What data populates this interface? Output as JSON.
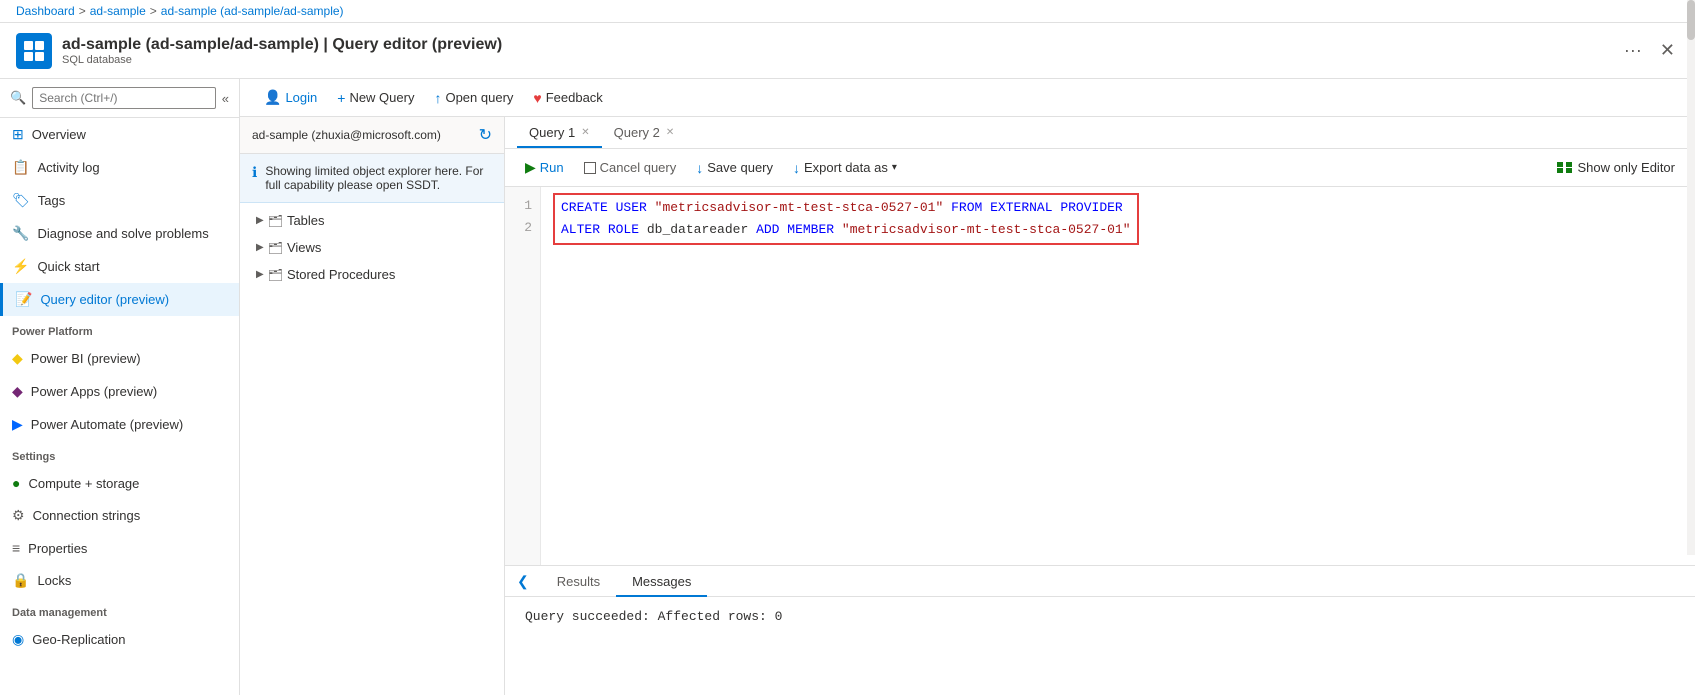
{
  "breadcrumb": {
    "items": [
      "Dashboard",
      "ad-sample",
      "ad-sample (ad-sample/ad-sample)"
    ]
  },
  "header": {
    "title": "ad-sample (ad-sample/ad-sample) | Query editor (preview)",
    "subtitle": "SQL database",
    "dots_label": "···",
    "close_label": "✕"
  },
  "sidebar": {
    "search_placeholder": "Search (Ctrl+/)",
    "collapse_icon": "«",
    "nav_items": [
      {
        "id": "overview",
        "label": "Overview",
        "icon": "overview"
      },
      {
        "id": "activity-log",
        "label": "Activity log",
        "icon": "log"
      },
      {
        "id": "tags",
        "label": "Tags",
        "icon": "tags"
      },
      {
        "id": "diagnose",
        "label": "Diagnose and solve problems",
        "icon": "diagnose"
      },
      {
        "id": "quick-start",
        "label": "Quick start",
        "icon": "quick"
      },
      {
        "id": "query-editor",
        "label": "Query editor (preview)",
        "icon": "editor"
      }
    ],
    "sections": [
      {
        "label": "Power Platform",
        "items": [
          {
            "id": "power-bi",
            "label": "Power BI (preview)",
            "icon": "powerbi"
          },
          {
            "id": "power-apps",
            "label": "Power Apps (preview)",
            "icon": "powerapps"
          },
          {
            "id": "power-automate",
            "label": "Power Automate (preview)",
            "icon": "powerautomate"
          }
        ]
      },
      {
        "label": "Settings",
        "items": [
          {
            "id": "compute-storage",
            "label": "Compute + storage",
            "icon": "compute"
          },
          {
            "id": "connection-strings",
            "label": "Connection strings",
            "icon": "connection"
          },
          {
            "id": "properties",
            "label": "Properties",
            "icon": "properties"
          },
          {
            "id": "locks",
            "label": "Locks",
            "icon": "locks"
          }
        ]
      },
      {
        "label": "Data management",
        "items": [
          {
            "id": "geo-replication",
            "label": "Geo-Replication",
            "icon": "geo"
          }
        ]
      }
    ]
  },
  "toolbar": {
    "login_label": "Login",
    "new_query_label": "New Query",
    "open_query_label": "Open query",
    "feedback_label": "Feedback"
  },
  "explorer": {
    "connection": "ad-sample (zhuxia@microsoft.com)",
    "info_text": "Showing limited object explorer here. For full capability please open SSDT.",
    "tree_items": [
      {
        "label": "Tables",
        "icon": "table"
      },
      {
        "label": "Views",
        "icon": "view"
      },
      {
        "label": "Stored Procedures",
        "icon": "stored-proc"
      }
    ]
  },
  "query_editor": {
    "tabs": [
      {
        "label": "Query 1",
        "active": true,
        "closeable": true
      },
      {
        "label": "Query 2",
        "active": false,
        "closeable": true
      }
    ],
    "toolbar": {
      "run_label": "Run",
      "cancel_label": "Cancel query",
      "save_label": "Save query",
      "export_label": "Export data as",
      "show_editor_label": "Show only Editor"
    },
    "code": {
      "line1": "CREATE USER \"metricsadvisor-mt-test-stca-0527-01\" FROM EXTERNAL PROVIDER",
      "line2": "ALTER ROLE db_datareader ADD MEMBER \"metricsadvisor-mt-test-stca-0527-01\""
    }
  },
  "results": {
    "tabs": [
      {
        "label": "Results",
        "active": false
      },
      {
        "label": "Messages",
        "active": true
      }
    ],
    "message": "Query succeeded: Affected rows: 0"
  }
}
